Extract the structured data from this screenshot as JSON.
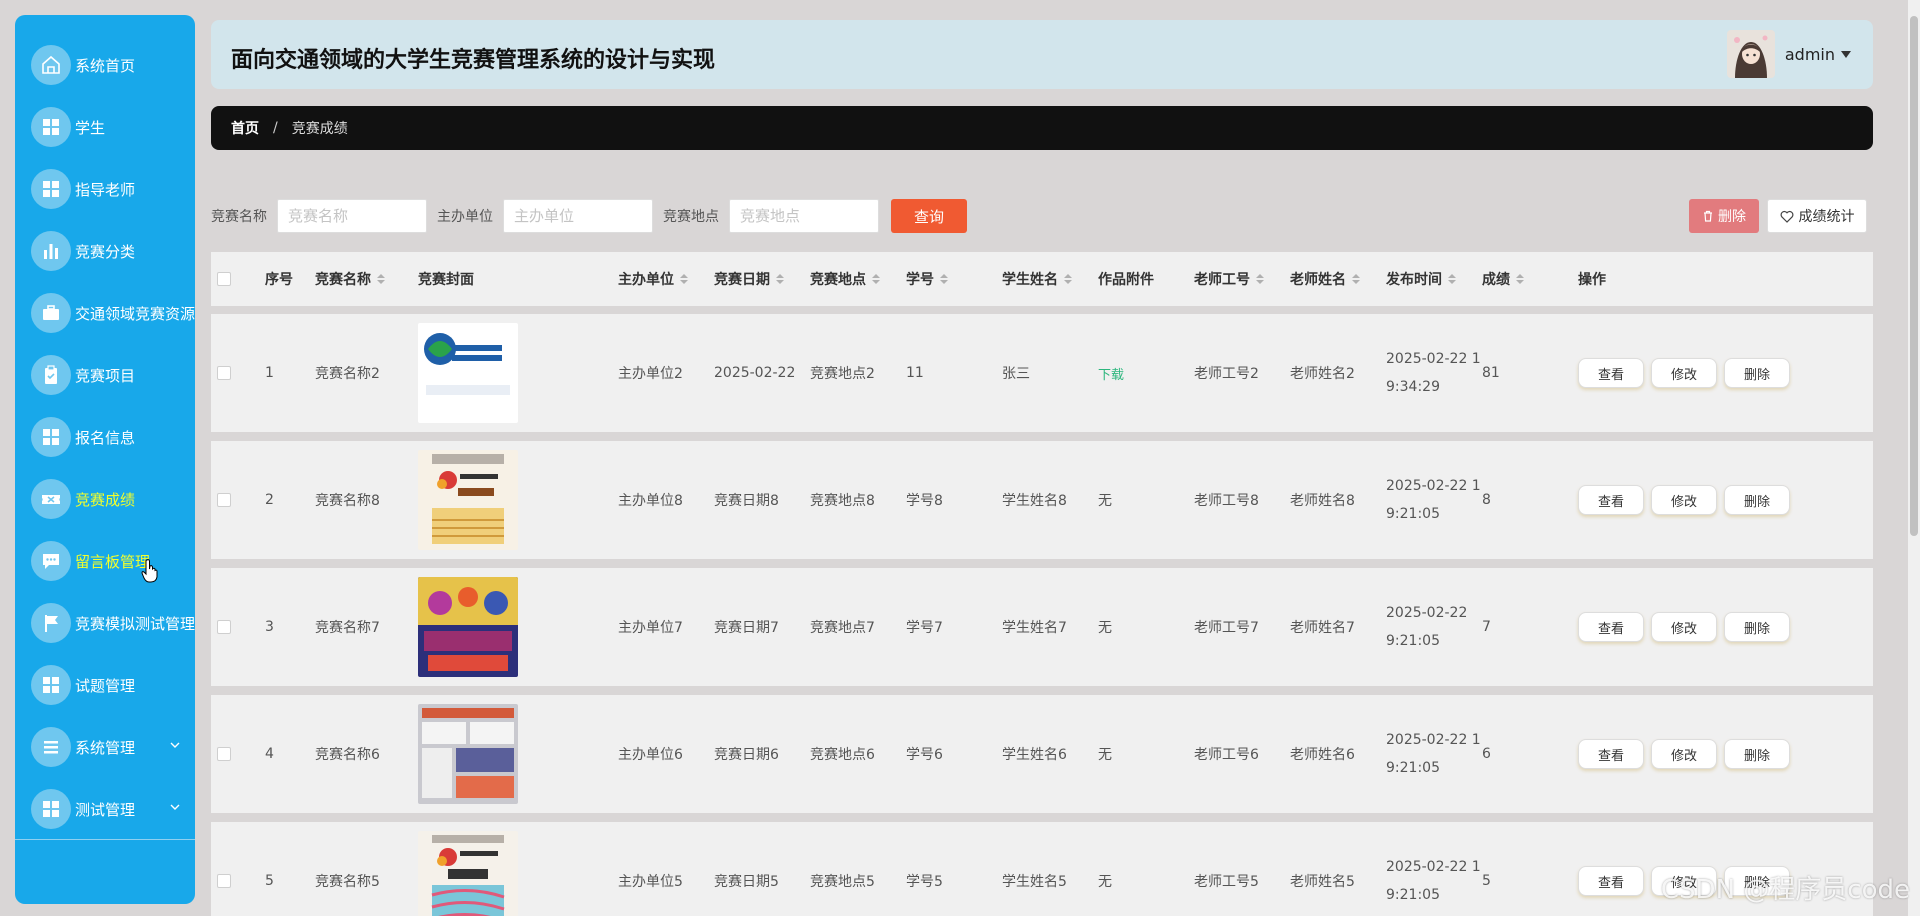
{
  "sidebar": {
    "items": [
      {
        "label": "系统首页",
        "icon": "home-icon"
      },
      {
        "label": "学生",
        "icon": "grid-icon"
      },
      {
        "label": "指导老师",
        "icon": "grid-icon"
      },
      {
        "label": "竞赛分类",
        "icon": "bar-chart-icon"
      },
      {
        "label": "交通领域竞赛资源",
        "icon": "briefcase-icon"
      },
      {
        "label": "竞赛项目",
        "icon": "clipboard-icon"
      },
      {
        "label": "报名信息",
        "icon": "grid-icon"
      },
      {
        "label": "竞赛成绩",
        "icon": "ticket-icon",
        "active": true
      },
      {
        "label": "留言板管理",
        "icon": "chat-icon",
        "hover": true
      },
      {
        "label": "竞赛模拟测试管理",
        "icon": "flag-icon"
      },
      {
        "label": "试题管理",
        "icon": "grid-icon"
      },
      {
        "label": "系统管理",
        "icon": "list-icon",
        "expandable": true
      },
      {
        "label": "测试管理",
        "icon": "grid-icon",
        "expandable": true
      }
    ]
  },
  "header": {
    "title": "面向交通领域的大学生竞赛管理系统的设计与实现",
    "user": "admin"
  },
  "breadcrumb": {
    "home": "首页",
    "separator": "/",
    "current": "竞赛成绩"
  },
  "search": {
    "fields": [
      {
        "label": "竞赛名称",
        "placeholder": "竞赛名称"
      },
      {
        "label": "主办单位",
        "placeholder": "主办单位"
      },
      {
        "label": "竞赛地点",
        "placeholder": "竞赛地点"
      }
    ],
    "query_label": "查询"
  },
  "toolbar": {
    "delete_label": "删除",
    "stats_label": "成绩统计"
  },
  "table": {
    "columns": [
      "序号",
      "竞赛名称",
      "竞赛封面",
      "主办单位",
      "竞赛日期",
      "竞赛地点",
      "学号",
      "学生姓名",
      "作品附件",
      "老师工号",
      "老师姓名",
      "发布时间",
      "成绩",
      "操作"
    ],
    "rows": [
      {
        "index": "1",
        "name": "竞赛名称2",
        "org": "主办单位2",
        "date": "2025-02-22",
        "place": "竞赛地点2",
        "sid": "11",
        "sname": "张三",
        "attach": "下载",
        "tid": "老师工号2",
        "tname": "老师姓名2",
        "time1": "2025-02-22 1",
        "time2": "9:34:29",
        "score": "81"
      },
      {
        "index": "2",
        "name": "竞赛名称8",
        "org": "主办单位8",
        "date": "竞赛日期8",
        "place": "竞赛地点8",
        "sid": "学号8",
        "sname": "学生姓名8",
        "attach": "无",
        "tid": "老师工号8",
        "tname": "老师姓名8",
        "time1": "2025-02-22 1",
        "time2": "9:21:05",
        "score": "8"
      },
      {
        "index": "3",
        "name": "竞赛名称7",
        "org": "主办单位7",
        "date": "竞赛日期7",
        "place": "竞赛地点7",
        "sid": "学号7",
        "sname": "学生姓名7",
        "attach": "无",
        "tid": "老师工号7",
        "tname": "老师姓名7",
        "time1": "2025-02-22",
        "time2": "9:21:05",
        "score": "7"
      },
      {
        "index": "4",
        "name": "竞赛名称6",
        "org": "主办单位6",
        "date": "竞赛日期6",
        "place": "竞赛地点6",
        "sid": "学号6",
        "sname": "学生姓名6",
        "attach": "无",
        "tid": "老师工号6",
        "tname": "老师姓名6",
        "time1": "2025-02-22 1",
        "time2": "9:21:05",
        "score": "6"
      },
      {
        "index": "5",
        "name": "竞赛名称5",
        "org": "主办单位5",
        "date": "竞赛日期5",
        "place": "竞赛地点5",
        "sid": "学号5",
        "sname": "学生姓名5",
        "attach": "无",
        "tid": "老师工号5",
        "tname": "老师姓名5",
        "time1": "2025-02-22 1",
        "time2": "9:21:05",
        "score": "5"
      }
    ],
    "actions": [
      "查看",
      "修改",
      "删除"
    ]
  },
  "watermark": "CSDN @程序员code",
  "colors": {
    "sidebar": "#18a8ea",
    "active_text": "#f3ff2a",
    "query_button": "#f05a32",
    "delete_button": "#e27b7e",
    "download_link": "#2cb67d"
  }
}
